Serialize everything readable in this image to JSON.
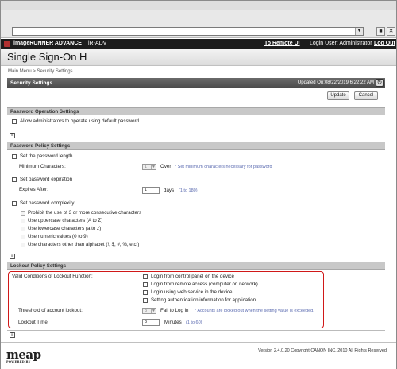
{
  "browser": {
    "dropdown_glyph": "▼",
    "buttons": [
      "■",
      "✕"
    ]
  },
  "header": {
    "brand": "imageRUNNER ADVANCE",
    "model": "iR-ADV",
    "remote_ui_link": "To Remote UI",
    "login_user": "Login User: Administrator",
    "logout_link": "Log Out",
    "app_title": "Single Sign-On H"
  },
  "breadcrumb": "Main Menu > Security Settings",
  "page": {
    "title": "Security Settings",
    "updated": "Updated On:08/22/2019 6:22:22 AM",
    "refresh_glyph": "↻",
    "update_button": "Update",
    "cancel_button": "Cancel"
  },
  "password_operation": {
    "title": "Password Operation Settings",
    "allow_default": "Allow administrators to operate using default password"
  },
  "password_policy": {
    "title": "Password Policy Settings",
    "set_length": "Set the password length",
    "min_chars_label": "Minimum Characters:",
    "min_chars_value": "1",
    "over_label": "Over",
    "min_chars_note": "* Set minimum characters necessary for password",
    "set_expiration": "Set password expiration",
    "expires_label": "Expires After:",
    "expires_value": "1",
    "days_label": "days",
    "days_range": "(1 to 180)",
    "set_complexity": "Set password complexity",
    "complexity_options": [
      "Prohibit the use of 3 or more consecutive characters",
      "Use uppercase characters (A to Z)",
      "Use lowercase characters (a to z)",
      "Use numeric values (0 to 9)",
      "Use characters other than alphabet (!, $, #, %, etc.)"
    ]
  },
  "lockout": {
    "title": "Lockout Policy Settings",
    "valid_conditions_label": "Valid Conditions of Lockout Function:",
    "conditions": [
      "Login from control panel on the device",
      "Login from remote access (computer on network)",
      "Login using web service in the device",
      "Setting authentication information for application"
    ],
    "threshold_label": "Threshold of account lockout:",
    "threshold_value": "3",
    "fail_label": "Fail to Log in",
    "threshold_note": "* Accounts are locked out when the setting value is exceeded.",
    "lockout_time_label": "Lockout Time:",
    "lockout_time_value": "3",
    "minutes_label": "Minutes",
    "minutes_range": "(1 to 60)"
  },
  "toggle_glyph": "≡",
  "footer": {
    "logo": "meap",
    "logo_sub": "POWERED BY",
    "copyright": "Version 2.4.0.20 Copyright CANON INC. 2010 All Rights Reserved"
  }
}
